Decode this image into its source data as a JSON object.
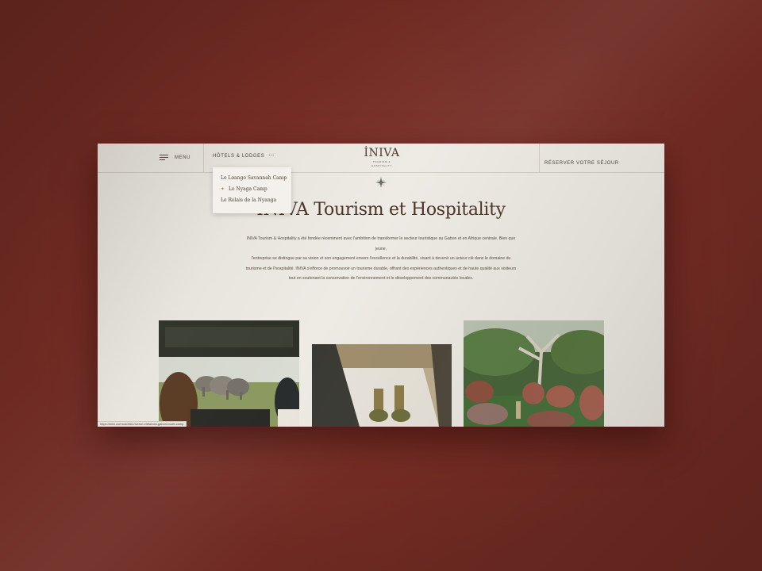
{
  "header": {
    "menu_label": "MENU",
    "hotels_label": "HÔTELS & LODGES",
    "more_icon": "⋯",
    "logo_text": "İNIVA",
    "logo_tagline": "TOURISM & HOSPITALITY",
    "reserve_label": "RÉSERVER VOTRE SÉJOUR"
  },
  "dropdown": {
    "items": [
      {
        "label": "Le Loango Savannah Camp"
      },
      {
        "label": "Le Nyaga Camp",
        "marker": "✦"
      },
      {
        "label": "Le Relais de la Nyanga"
      }
    ]
  },
  "main": {
    "title": "İNIVA Tourism et Hospitality",
    "intro_p1": "INIVA Tourism & Hospitality a été fondée récemment avec l'ambition de transformer le secteur touristique au Gabon et en Afrique centrale. Bien que jeune,",
    "intro_p2": "l'entreprise se distingue par sa vision et son engagement envers l'excellence et la durabilité, visant à devenir un acteur clé dans le domaine du tourisme et de l'hospitalité. INIVA s'efforce de promouvoir un tourisme durable, offrant des expériences authentiques et de haute qualité aux visiteurs tout en soutenant la conservation de l'environnement et le développement des communautés locales."
  },
  "status_url": "https://inivi.co/mod/38d-riverce-elefancia-gabon-tourit-camp",
  "colors": {
    "background": "#6e2a22",
    "page": "#eeebe5",
    "text_dark": "#4a3226",
    "accent_gold": "#b38a4a"
  },
  "icons": {
    "menu": "hamburger-icon",
    "more": "more-dots-icon",
    "compass": "compass-star-icon"
  }
}
